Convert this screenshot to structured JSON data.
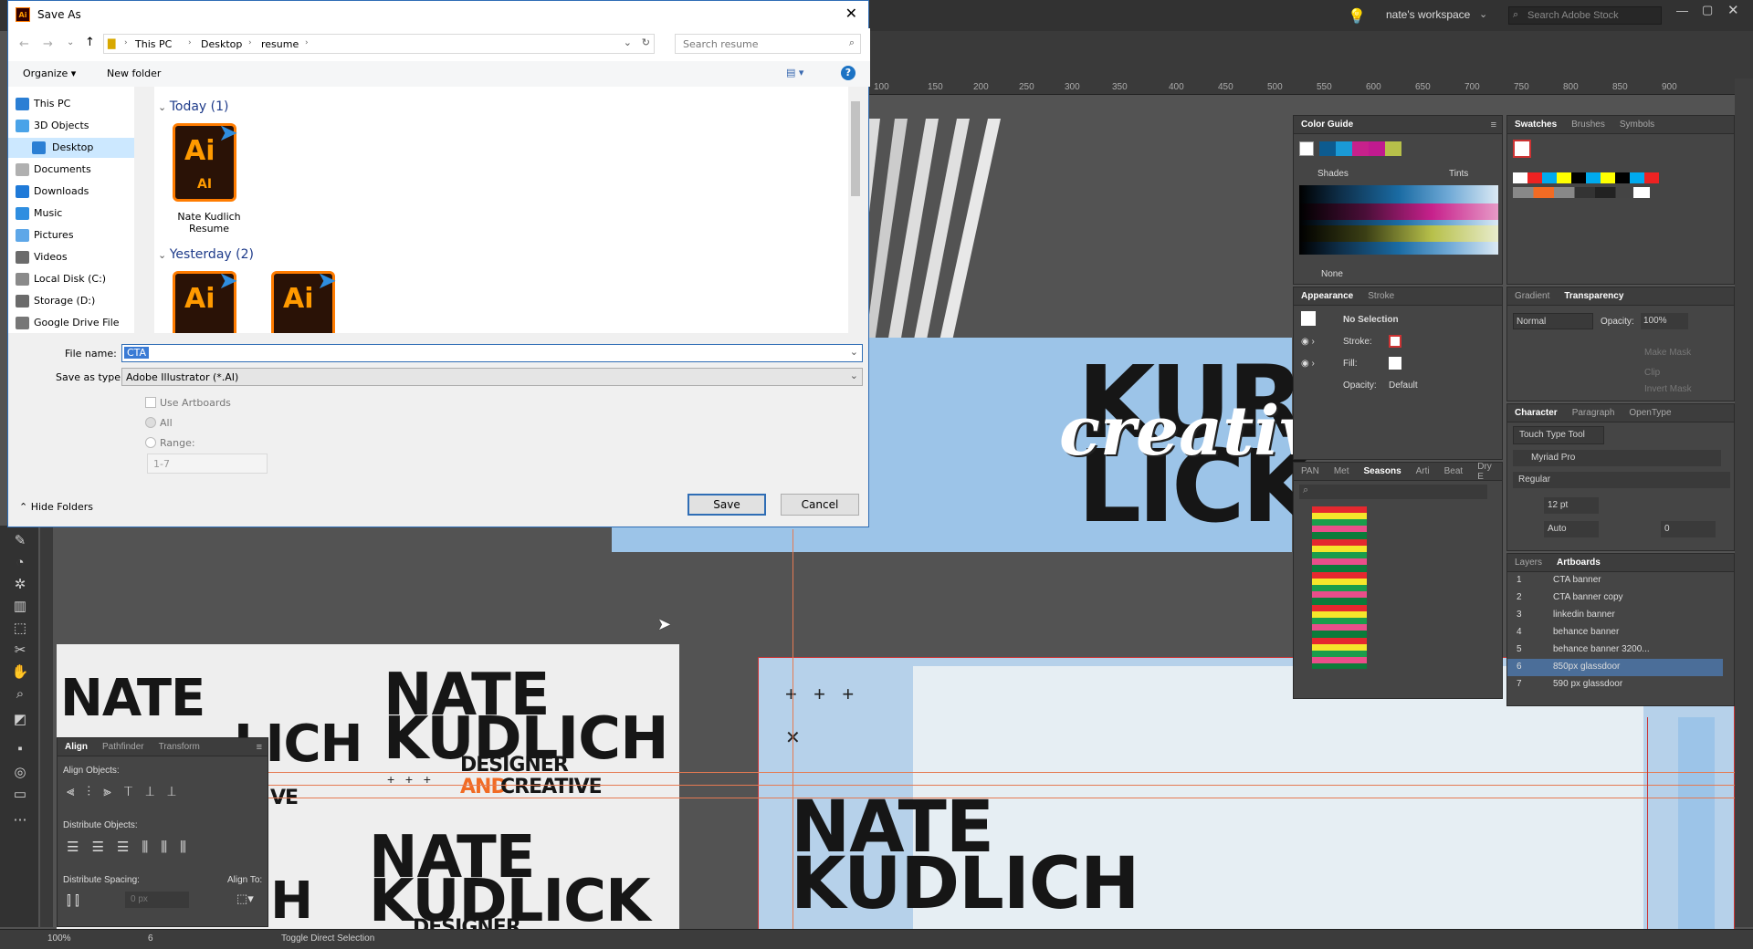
{
  "app": {
    "workspace": "nate's workspace",
    "search_stock_placeholder": "Search Adobe Stock",
    "ruler_ticks": [
      "100",
      "150",
      "200",
      "250",
      "300",
      "350",
      "400",
      "450",
      "500",
      "550",
      "600",
      "650",
      "700",
      "750",
      "800",
      "850",
      "900"
    ]
  },
  "dialog": {
    "title": "Save As",
    "breadcrumb": [
      "This PC",
      "Desktop",
      "resume"
    ],
    "search_placeholder": "Search resume",
    "organize_label": "Organize ▾",
    "new_folder_label": "New folder",
    "nav_items": [
      "This PC",
      "3D Objects",
      "Desktop",
      "Documents",
      "Downloads",
      "Music",
      "Pictures",
      "Videos",
      "Local Disk (C:)",
      "Storage (D:)",
      "Google Drive File"
    ],
    "group_today": "Today (1)",
    "group_yesterday": "Yesterday (2)",
    "file_name_label": "File name:",
    "file_name_value": "CTA",
    "save_as_type_label": "Save as type:",
    "save_as_type_value": "Adobe Illustrator (*.AI)",
    "use_artboards_label": "Use Artboards",
    "all_label": "All",
    "range_label": "Range:",
    "range_value": "1-7",
    "hide_folders_label": "Hide Folders",
    "save_label": "Save",
    "cancel_label": "Cancel",
    "files": [
      {
        "name": "Nate Kudlich Resume",
        "icon_text": "Ai",
        "sub": "AI"
      }
    ],
    "yesterday_files": [
      {
        "icon_text": "Ai"
      },
      {
        "icon_text": "Ai"
      }
    ]
  },
  "canvas": {
    "kur": "KUR",
    "creative": "creativ",
    "lick": "LICK",
    "nate1": "NATE",
    "kudlich1": "KUDLICH",
    "nate2": "NATE",
    "kudlich2": "KUDLICH",
    "designer": "DESIGNER",
    "and_creative_and": "AND",
    "and_creative": "CREATIVE",
    "nate3": "NATE",
    "kudlick3": "KUDLICK",
    "designer3": "DESIGNER",
    "nate4": "NATE",
    "kudlich4": "KUDLICH",
    "partial1": "NATE",
    "partial2": "LICH",
    "partial3": "VE",
    "partial4": "CH"
  },
  "panels": {
    "color_guide": {
      "tab": "Color Guide",
      "shades": "Shades",
      "tints": "Tints",
      "none": "None"
    },
    "swatches": {
      "tabs": [
        "Swatches",
        "Brushes",
        "Symbols"
      ]
    },
    "appearance": {
      "tabs": [
        "Appearance",
        "Stroke"
      ],
      "no_selection": "No Selection",
      "stroke": "Stroke:",
      "fill": "Fill:",
      "opacity": "Opacity:",
      "opacity_value": "Default"
    },
    "gradient": {
      "tabs": [
        "Gradient",
        "Transparency"
      ],
      "mode": "Normal",
      "opacity_label": "Opacity:",
      "opacity_value": "100%",
      "make_mask": "Make Mask",
      "clip": "Clip",
      "invert": "Invert Mask"
    },
    "seasons": {
      "tabs": [
        "PAN",
        "Met",
        "Seasons",
        "Arti",
        "Beat",
        "Dry E"
      ]
    },
    "character": {
      "tabs": [
        "Character",
        "Paragraph",
        "OpenType"
      ],
      "touch": "Touch Type Tool",
      "font": "Myriad Pro",
      "style": "Regular",
      "size": "12 pt",
      "leading": "Auto",
      "tracking": "0"
    },
    "artboards": {
      "tabs": [
        "Layers",
        "Artboards"
      ],
      "items": [
        {
          "num": "1",
          "name": "CTA banner"
        },
        {
          "num": "2",
          "name": "CTA banner copy"
        },
        {
          "num": "3",
          "name": "linkedin banner"
        },
        {
          "num": "4",
          "name": "behance banner"
        },
        {
          "num": "5",
          "name": "behance banner 3200..."
        },
        {
          "num": "6",
          "name": "850px glassdoor"
        },
        {
          "num": "7",
          "name": "590 px glassdoor"
        }
      ],
      "selected": "6"
    },
    "align": {
      "tabs": [
        "Align",
        "Pathfinder",
        "Transform"
      ],
      "align_objects": "Align Objects:",
      "distribute_objects": "Distribute Objects:",
      "distribute_spacing": "Distribute Spacing:",
      "align_to": "Align To:",
      "spacing_value": "0 px"
    }
  },
  "status": {
    "zoom": "100%",
    "artboard_num": "6",
    "tool": "Toggle Direct Selection"
  }
}
